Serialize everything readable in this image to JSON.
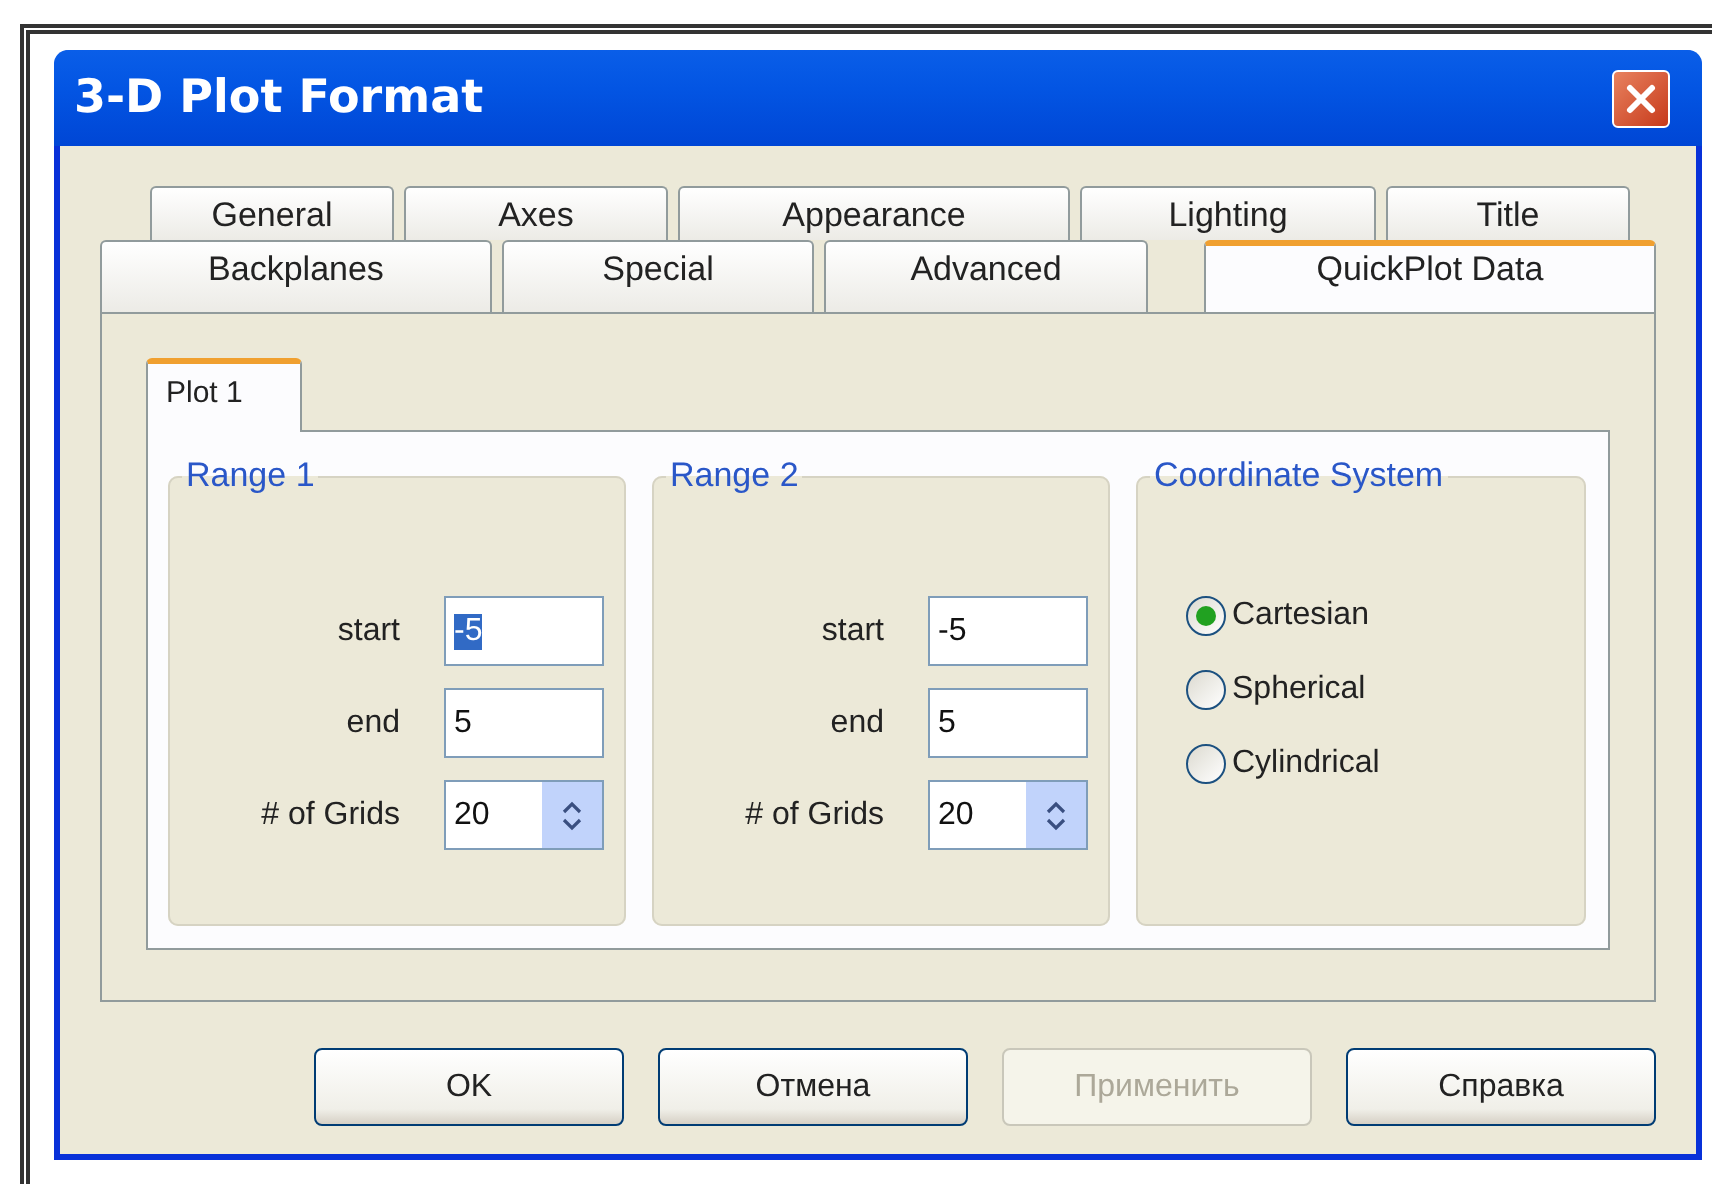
{
  "window": {
    "title": "3-D Plot Format"
  },
  "tab_rows": [
    [
      {
        "label": "General",
        "selected": false
      },
      {
        "label": "Axes",
        "selected": false
      },
      {
        "label": "Appearance",
        "selected": false
      },
      {
        "label": "Lighting",
        "selected": false
      },
      {
        "label": "Title",
        "selected": false
      }
    ],
    [
      {
        "label": "Backplanes",
        "selected": false
      },
      {
        "label": "Special",
        "selected": false
      },
      {
        "label": "Advanced",
        "selected": false
      },
      {
        "label": "QuickPlot Data",
        "selected": true
      }
    ]
  ],
  "inner_tabs": [
    {
      "label": "Plot 1",
      "selected": true
    }
  ],
  "groups": [
    {
      "kind": "range",
      "title": "Range 1",
      "fields": [
        {
          "kind": "text",
          "label": "start",
          "value": "-5",
          "highlighted": true
        },
        {
          "kind": "text",
          "label": "end",
          "value": "5",
          "highlighted": false
        },
        {
          "kind": "spin",
          "label": "# of Grids",
          "value": "20",
          "highlighted": false
        }
      ]
    },
    {
      "kind": "range",
      "title": "Range 2",
      "fields": [
        {
          "kind": "text",
          "label": "start",
          "value": "-5",
          "highlighted": false
        },
        {
          "kind": "text",
          "label": "end",
          "value": "5",
          "highlighted": false
        },
        {
          "kind": "spin",
          "label": "# of Grids",
          "value": "20",
          "highlighted": false
        }
      ]
    },
    {
      "kind": "radios",
      "title": "Coordinate System",
      "options": [
        {
          "label": "Cartesian",
          "selected": true
        },
        {
          "label": "Spherical",
          "selected": false
        },
        {
          "label": "Cylindrical",
          "selected": false
        }
      ]
    }
  ],
  "buttons": [
    {
      "label": "OK",
      "disabled": false
    },
    {
      "label": "Отмена",
      "disabled": false
    },
    {
      "label": "Применить",
      "disabled": true
    },
    {
      "label": "Справка",
      "disabled": false
    }
  ]
}
